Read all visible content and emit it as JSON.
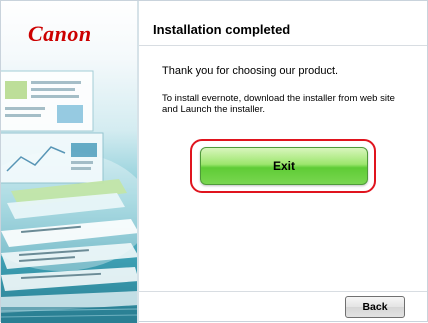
{
  "brand": {
    "logo_text": "Canon",
    "logo_color": "#cc0000"
  },
  "header": {
    "title": "Installation completed"
  },
  "main": {
    "thanks_text": "Thank you for choosing our product.",
    "info_text": "To install evernote, download the installer from web site and Launch the installer."
  },
  "buttons": {
    "exit_label": "Exit",
    "back_label": "Back"
  },
  "colors": {
    "exit_green": "#5fcc36",
    "highlight_red": "#e0141e",
    "panel_teal": "#3d9fb3"
  }
}
